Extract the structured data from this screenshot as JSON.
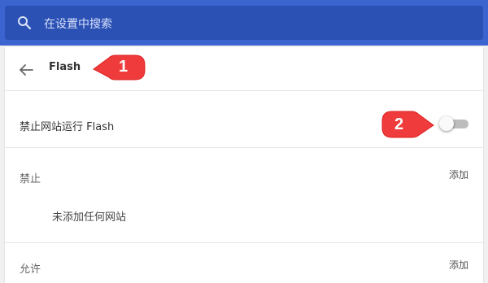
{
  "search": {
    "placeholder": "在设置中搜索"
  },
  "header": {
    "title": "Flash"
  },
  "setting": {
    "label": "禁止网站运行 Flash",
    "toggle_on": false
  },
  "block_section": {
    "title": "禁止",
    "add_label": "添加",
    "empty_text": "未添加任何网站"
  },
  "allow_section": {
    "title": "允许",
    "add_label": "添加"
  },
  "annotations": [
    {
      "number": "1"
    },
    {
      "number": "2"
    }
  ],
  "colors": {
    "header_bg": "#3b64cf",
    "search_bg": "#2c51b4",
    "callout_red": "#ef3b3b",
    "toggle_off": "#bdbdbd"
  },
  "icons": [
    "search-icon",
    "arrow-left-icon"
  ]
}
